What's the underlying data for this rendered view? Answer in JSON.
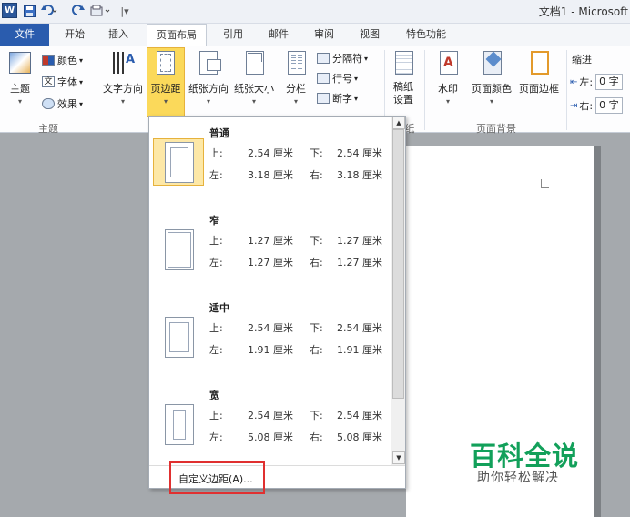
{
  "titlebar": {
    "app_logo": "W",
    "doc_title": "文档1 - Microsoft",
    "icons": [
      "save-icon",
      "undo-icon",
      "redo-icon",
      "customize-icon"
    ]
  },
  "tabs": [
    {
      "label": "文件"
    },
    {
      "label": "开始"
    },
    {
      "label": "插入"
    },
    {
      "label": "页面布局"
    },
    {
      "label": "引用"
    },
    {
      "label": "邮件"
    },
    {
      "label": "审阅"
    },
    {
      "label": "视图"
    },
    {
      "label": "特色功能"
    }
  ],
  "ribbon": {
    "theme_group": {
      "label": "主题",
      "theme_btn": "主题",
      "colors": "颜色",
      "fonts": "字体",
      "effects": "效果"
    },
    "page_setup": {
      "text_direction": "文字方向",
      "margins": "页边距",
      "orientation": "纸张方向",
      "size": "纸张大小",
      "columns": "分栏",
      "breaks": "分隔符",
      "line_numbers": "行号",
      "hyphenation": "断字"
    },
    "paper_group": {
      "label": "纸",
      "setting": "稿纸设置"
    },
    "background_group": {
      "label": "页面背景",
      "watermark": "水印",
      "page_color": "页面颜色",
      "page_borders": "页面边框"
    },
    "indent": {
      "label": "缩进",
      "left_label": "左:",
      "left_value": "0 字",
      "right_label": "右:",
      "right_value": "0 字"
    }
  },
  "margins_menu": {
    "options": [
      {
        "name": "普通",
        "top_label": "上:",
        "top": "2.54 厘米",
        "bottom_label": "下:",
        "bottom": "2.54 厘米",
        "left_label": "左:",
        "left": "3.18 厘米",
        "right_label": "右:",
        "right": "3.18 厘米"
      },
      {
        "name": "窄",
        "top_label": "上:",
        "top": "1.27 厘米",
        "bottom_label": "下:",
        "bottom": "1.27 厘米",
        "left_label": "左:",
        "left": "1.27 厘米",
        "right_label": "右:",
        "right": "1.27 厘米"
      },
      {
        "name": "适中",
        "top_label": "上:",
        "top": "2.54 厘米",
        "bottom_label": "下:",
        "bottom": "2.54 厘米",
        "left_label": "左:",
        "left": "1.91 厘米",
        "right_label": "右:",
        "right": "1.91 厘米"
      },
      {
        "name": "宽",
        "top_label": "上:",
        "top": "2.54 厘米",
        "bottom_label": "下:",
        "bottom": "2.54 厘米",
        "left_label": "左:",
        "left": "5.08 厘米",
        "right_label": "右:",
        "right": "5.08 厘米"
      }
    ],
    "custom_label": "自定义边距(A)..."
  },
  "watermark": {
    "logo_text": "百科全说",
    "sub_text": "助你轻松解决"
  },
  "colors": {
    "file_tab": "#2a5cae",
    "highlight": "#fbd95a",
    "callout_border": "#e03030",
    "watermark_green": "#12a05a"
  }
}
